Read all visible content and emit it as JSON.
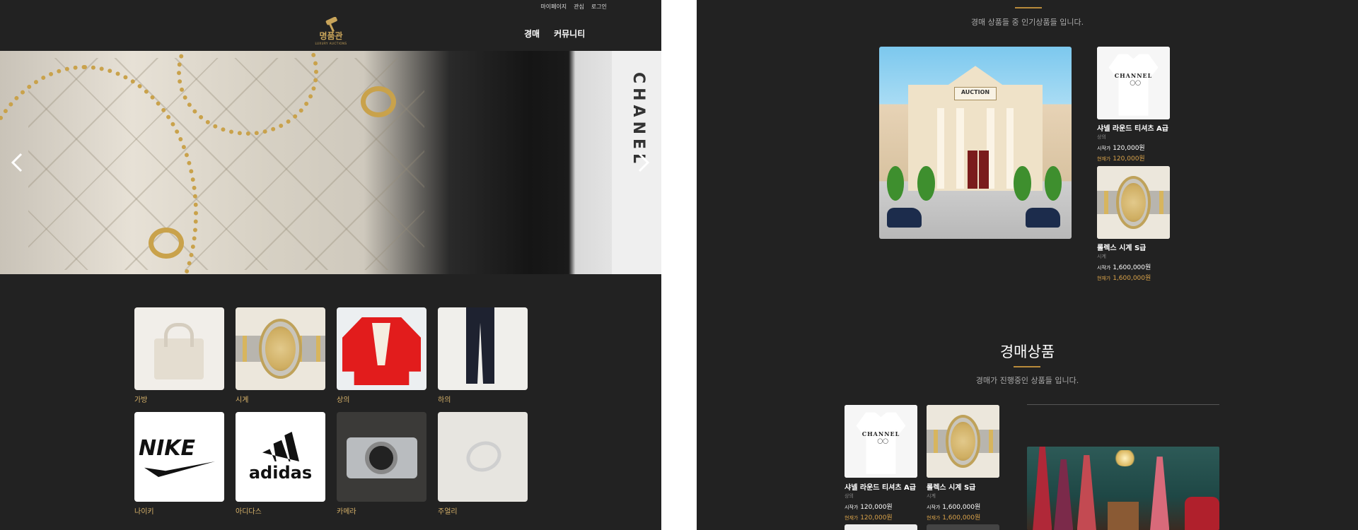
{
  "header": {
    "util_links": [
      "마이페이지",
      "관심",
      "로그인"
    ],
    "logo_text": "명품관",
    "logo_sub": "LUXURY AUCTIONS",
    "nav": [
      "경매",
      "커뮤니티"
    ]
  },
  "hero": {
    "strap_text": "CHANEL",
    "accent": "#c9a24b"
  },
  "categories": [
    {
      "label": "가방",
      "icon": "handbag-icon"
    },
    {
      "label": "시계",
      "icon": "watch-icon"
    },
    {
      "label": "상의",
      "icon": "top-icon"
    },
    {
      "label": "하의",
      "icon": "pants-icon"
    },
    {
      "label": "나이키",
      "icon": "nike-logo"
    },
    {
      "label": "아디다스",
      "icon": "adidas-logo"
    },
    {
      "label": "카메라",
      "icon": "camera-icon"
    },
    {
      "label": "주얼리",
      "icon": "ring-icon"
    }
  ],
  "popular": {
    "subtitle": "경매 상품들 중 인기상품들 입니다.",
    "banner_sign": "AUCTION",
    "items": [
      {
        "name": "샤넬 라운드 티셔츠 A급",
        "category": "상의",
        "start_label": "시작가",
        "start_price": "120,000원",
        "current_label": "현재가",
        "current_price": "120,000원",
        "brand": "CHANNEL"
      },
      {
        "name": "롤렉스 시계 S급",
        "category": "시계",
        "start_label": "시작가",
        "start_price": "1,600,000원",
        "current_label": "현재가",
        "current_price": "1,600,000원"
      }
    ]
  },
  "auction": {
    "title": "경매상품",
    "subtitle": "경매가 진행중인 상품들 입니다.",
    "items": [
      {
        "name": "샤넬 라운드 티셔츠 A급",
        "category": "상의",
        "start_label": "시작가",
        "start_price": "120,000원",
        "current_label": "현재가",
        "current_price": "120,000원",
        "brand": "CHANNEL"
      },
      {
        "name": "롤렉스 시계 S급",
        "category": "시계",
        "start_label": "시작가",
        "start_price": "1,600,000원",
        "current_label": "현재가",
        "current_price": "1,600,000원"
      }
    ]
  },
  "colors": {
    "background": "#222222",
    "gold": "#d8a24a",
    "divider": "#b88a3b"
  }
}
